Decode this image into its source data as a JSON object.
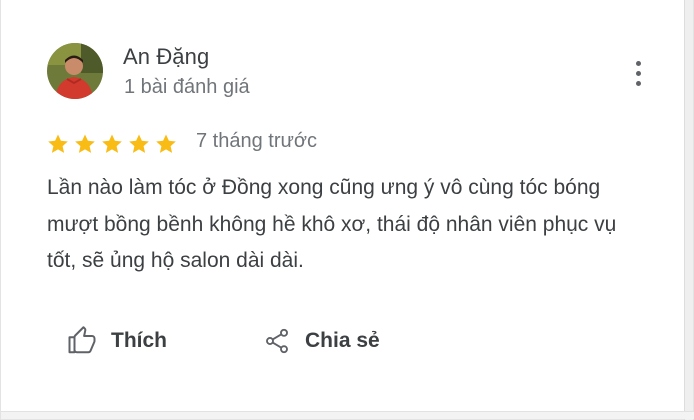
{
  "review": {
    "author": {
      "name": "An Đặng",
      "meta": "1 bài đánh giá"
    },
    "rating": 5,
    "rating_max": 5,
    "date": "7 tháng trước",
    "text": "Lần nào làm tóc ở Đồng xong cũng ưng ý vô cùng tóc bóng mượt bồng bềnh không hề khô xơ, thái độ nhân viên phục vụ tốt, sẽ ủng hộ salon dài dài.",
    "actions": {
      "like_label": "Thích",
      "share_label": "Chia sẻ"
    }
  },
  "icons": {
    "more": "more-vert-icon",
    "star": "star-icon",
    "like": "thumbs-up-icon",
    "share": "share-icon"
  },
  "colors": {
    "star": "#f9bc15",
    "text": "#3c4043",
    "secondary_text": "#70757a",
    "icon": "#5f6368"
  }
}
